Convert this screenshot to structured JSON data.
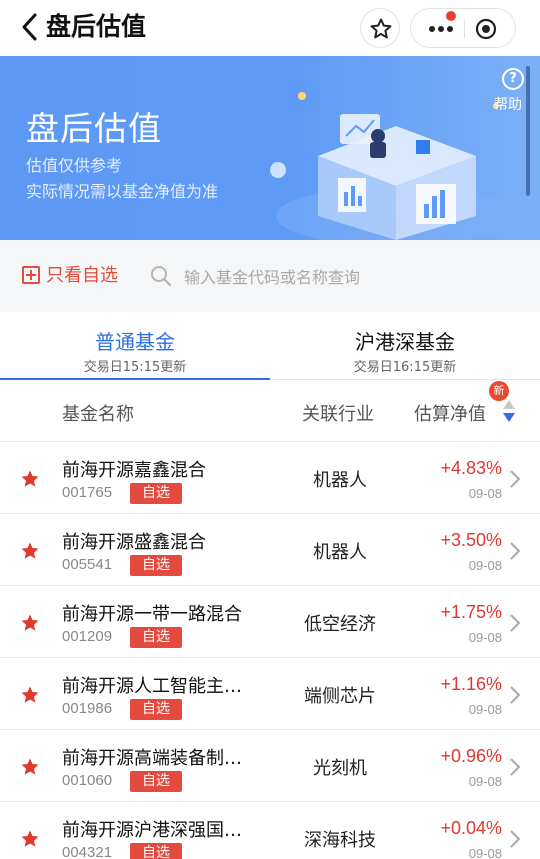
{
  "header": {
    "title": "盘后估值"
  },
  "banner": {
    "title": "盘后估值",
    "sub1": "估值仅供参考",
    "sub2": "实际情况需以基金净值为准",
    "help_label": "帮助"
  },
  "filter": {
    "only_fav_label": "只看自选",
    "search_placeholder": "输入基金代码或名称查询"
  },
  "tabs": [
    {
      "label": "普通基金",
      "time": "交易日15:15更新",
      "active": true
    },
    {
      "label": "沪港深基金",
      "time": "交易日16:15更新",
      "active": false
    }
  ],
  "list_header": {
    "name": "基金名称",
    "industry": "关联行业",
    "estimate": "估算净值",
    "new_badge": "新"
  },
  "rows": [
    {
      "name": "前海开源嘉鑫混合",
      "code": "001765",
      "tag": "自选",
      "industry": "机器人",
      "change": "+4.83%",
      "date": "09-08"
    },
    {
      "name": "前海开源盛鑫混合",
      "code": "005541",
      "tag": "自选",
      "industry": "机器人",
      "change": "+3.50%",
      "date": "09-08"
    },
    {
      "name": "前海开源一带一路混合",
      "code": "001209",
      "tag": "自选",
      "industry": "低空经济",
      "change": "+1.75%",
      "date": "09-08"
    },
    {
      "name": "前海开源人工智能主…",
      "code": "001986",
      "tag": "自选",
      "industry": "端侧芯片",
      "change": "+1.16%",
      "date": "09-08"
    },
    {
      "name": "前海开源高端装备制…",
      "code": "001060",
      "tag": "自选",
      "industry": "光刻机",
      "change": "+0.96%",
      "date": "09-08"
    },
    {
      "name": "前海开源沪港深强国…",
      "code": "004321",
      "tag": "自选",
      "industry": "深海科技",
      "change": "+0.04%",
      "date": "09-08"
    }
  ],
  "colors": {
    "accent": "#2f6ee3",
    "up": "#e0392e",
    "tag": "#e54a3f",
    "banner": "#5e98f5"
  },
  "icons": {
    "back": "chevron-left-icon",
    "favorite": "star-outline-icon",
    "more": "more-dots-icon",
    "close": "target-icon",
    "help": "question-icon",
    "search": "search-icon",
    "row_star": "star-filled-icon",
    "row_chevron": "chevron-right-icon",
    "sort": "sort-icon"
  }
}
